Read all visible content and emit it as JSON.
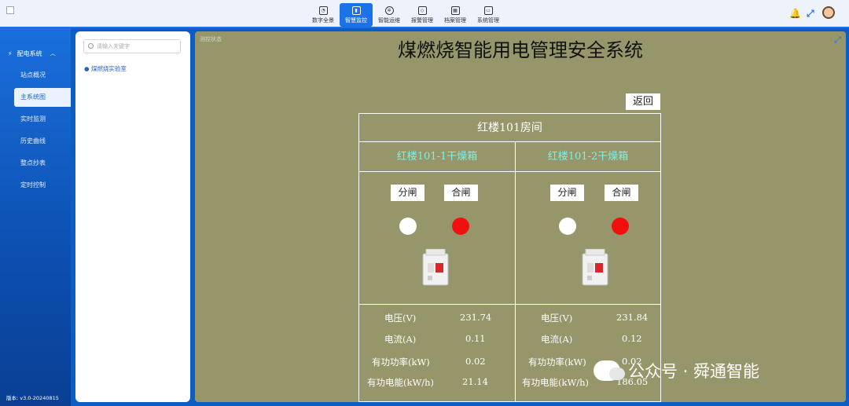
{
  "topnav": [
    {
      "label": "数字全景",
      "icon": "dashboard-icon",
      "active": false
    },
    {
      "label": "智慧监控",
      "icon": "bar-chart-icon",
      "active": true
    },
    {
      "label": "智能运维",
      "icon": "gear-icon",
      "active": false
    },
    {
      "label": "报警管理",
      "icon": "alarm-icon",
      "active": false
    },
    {
      "label": "档案管理",
      "icon": "grid-icon",
      "active": false
    },
    {
      "label": "系统管理",
      "icon": "monitor-icon",
      "active": false
    }
  ],
  "sidebar": {
    "group_label": "配电系统",
    "items": [
      {
        "label": "站点概况",
        "active": false
      },
      {
        "label": "主系统图",
        "active": true
      },
      {
        "label": "实时监测",
        "active": false
      },
      {
        "label": "历史曲线",
        "active": false
      },
      {
        "label": "整点抄表",
        "active": false
      },
      {
        "label": "定时控制",
        "active": false
      }
    ],
    "version": "版本: v3.0-20240815"
  },
  "tree": {
    "search_placeholder": "请输入关键字",
    "node": "煤燃烧实验室"
  },
  "main": {
    "tag": "测控状态",
    "title": "煤燃烧智能用电管理安全系统",
    "back_label": "返回",
    "room_title": "红楼101房间",
    "boxes": [
      {
        "title": "红楼101-1干燥箱",
        "open_label": "分闸",
        "close_label": "合闸",
        "voltage_label": "电压(V)",
        "voltage": "231.74",
        "current_label": "电流(A)",
        "current": "0.11",
        "power_label": "有功功率(kW)",
        "power": "0.02",
        "energy_label": "有功电能(kW/h)",
        "energy": "21.14"
      },
      {
        "title": "红楼101-2干燥箱",
        "open_label": "分闸",
        "close_label": "合闸",
        "voltage_label": "电压(V)",
        "voltage": "231.84",
        "current_label": "电流(A)",
        "current": "0.12",
        "power_label": "有功功率(kW)",
        "power": "0.02",
        "energy_label": "有功电能(kW/h)",
        "energy": "186.05"
      }
    ]
  },
  "watermark": "公众号 · 舜通智能",
  "colors": {
    "accent": "#1a73e8",
    "panel_bg": "#96966a",
    "title_cyan": "#7ef0e6",
    "lamp_red": "#f01010"
  }
}
